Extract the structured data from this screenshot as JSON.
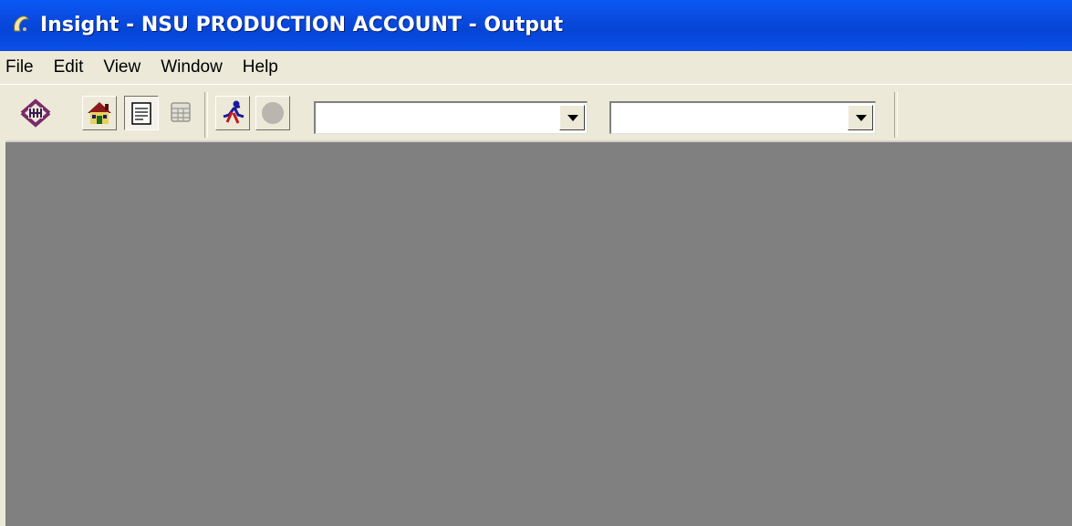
{
  "window": {
    "title": "Insight - NSU PRODUCTION ACCOUNT - Output",
    "title_bar_color": "#0a4be0",
    "client_background": "#808080"
  },
  "menu": {
    "items": [
      {
        "label": "File"
      },
      {
        "label": "Edit"
      },
      {
        "label": "View"
      },
      {
        "label": "Window"
      },
      {
        "label": "Help"
      }
    ]
  },
  "toolbar": {
    "buttons": [
      {
        "icon": "insight-logo-icon"
      },
      {
        "icon": "home-icon"
      },
      {
        "icon": "document-icon"
      },
      {
        "icon": "table-icon"
      },
      {
        "icon": "runner-icon"
      },
      {
        "icon": "stop-circle-icon"
      }
    ],
    "combo1": {
      "value": ""
    },
    "combo2": {
      "value": ""
    }
  }
}
